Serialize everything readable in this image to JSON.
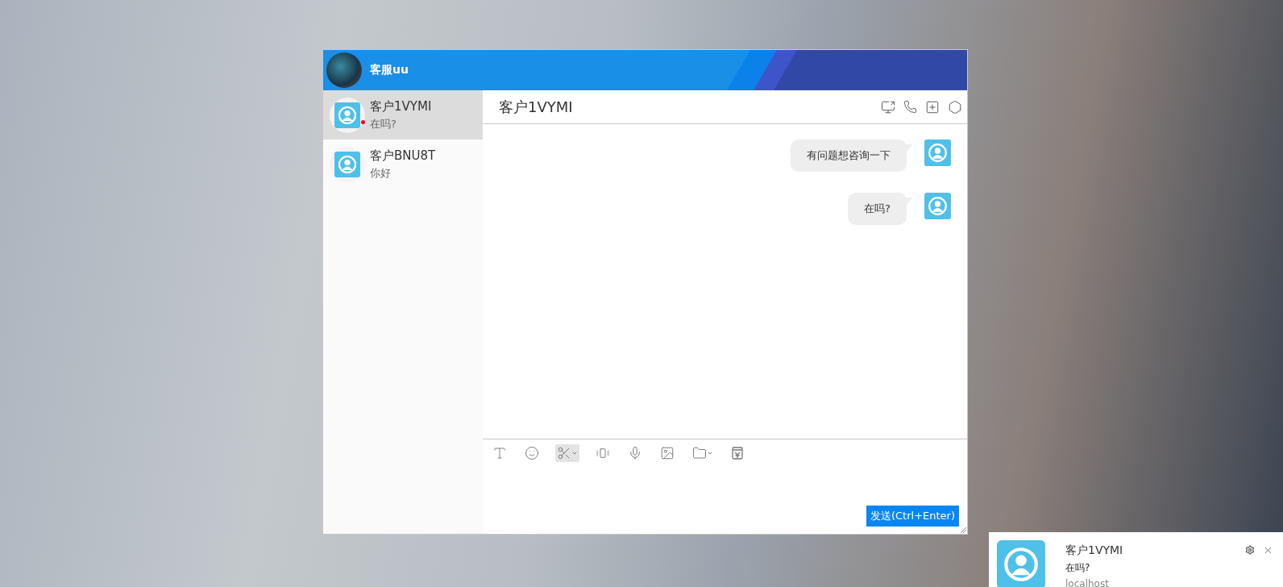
{
  "header": {
    "user_name": "客服uu"
  },
  "conversations": [
    {
      "name": "客户1VYMI",
      "preview": "在吗?",
      "selected": true,
      "unread": true
    },
    {
      "name": "客户BNU8T",
      "preview": "你好",
      "selected": false,
      "unread": false
    }
  ],
  "chat": {
    "title": "客户1VYMI",
    "messages": [
      {
        "text": "有问题想咨询一下"
      },
      {
        "text": "在吗?"
      }
    ]
  },
  "toolbar": [
    {
      "kind": "font",
      "selected": false
    },
    {
      "kind": "emoji",
      "selected": false
    },
    {
      "kind": "screenshot",
      "selected": true
    },
    {
      "kind": "shake",
      "selected": false
    },
    {
      "kind": "voice",
      "selected": false
    },
    {
      "kind": "image",
      "selected": false
    },
    {
      "kind": "file",
      "selected": false
    },
    {
      "kind": "redpacket",
      "selected": false
    }
  ],
  "send_button": "发送(Ctrl+Enter)",
  "notification": {
    "title": "客户1VYMI",
    "body": "在吗?",
    "source": "localhost"
  }
}
